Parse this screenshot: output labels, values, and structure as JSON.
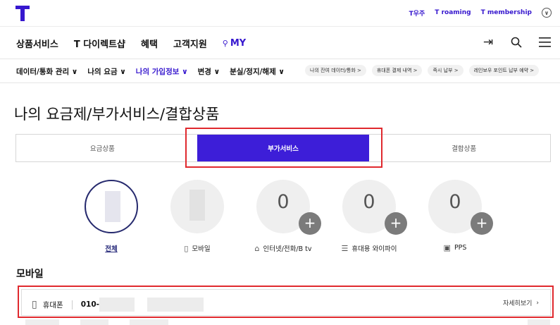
{
  "top_links": [
    "T우주",
    "T roaming",
    "T membership"
  ],
  "gnb": {
    "items": [
      "상품서비스",
      "T 다이렉트샵",
      "혜택",
      "고객지원"
    ],
    "my": "MY"
  },
  "lnb": {
    "items": [
      "데이터/통화 관리",
      "나의 요금",
      "나의 가입정보",
      "변경",
      "분실/정지/해제"
    ],
    "active_index": 2,
    "pills": [
      "나의 잔여 데이터/통화 >",
      "휴대폰 결제 내역 >",
      "즉시 납부 >",
      "레인보우 포인트 납부 예약 >"
    ]
  },
  "page_title": "나의 요금제/부가서비스/결합상품",
  "tabs": [
    "요금상품",
    "부가서비스",
    "결합상품"
  ],
  "active_tab": 1,
  "categories": [
    {
      "label": "전체",
      "count": "",
      "selected": true,
      "icon": ""
    },
    {
      "label": "모바일",
      "count": "",
      "selected": false,
      "icon": "mobile-icon"
    },
    {
      "label": "인터넷/전화/B tv",
      "count": "0",
      "selected": false,
      "icon": "home-icon"
    },
    {
      "label": "휴대용 와이파이",
      "count": "0",
      "selected": false,
      "icon": "router-icon"
    },
    {
      "label": "PPS",
      "count": "0",
      "selected": false,
      "icon": "phone-icon"
    }
  ],
  "section_title": "모바일",
  "line_row": {
    "device": "휴대폰",
    "number": "010-",
    "detail": "자세히보기"
  },
  "colors": {
    "brand": "#3617ce",
    "active_tab": "#3d1ed8",
    "highlight": "#e0292e"
  }
}
